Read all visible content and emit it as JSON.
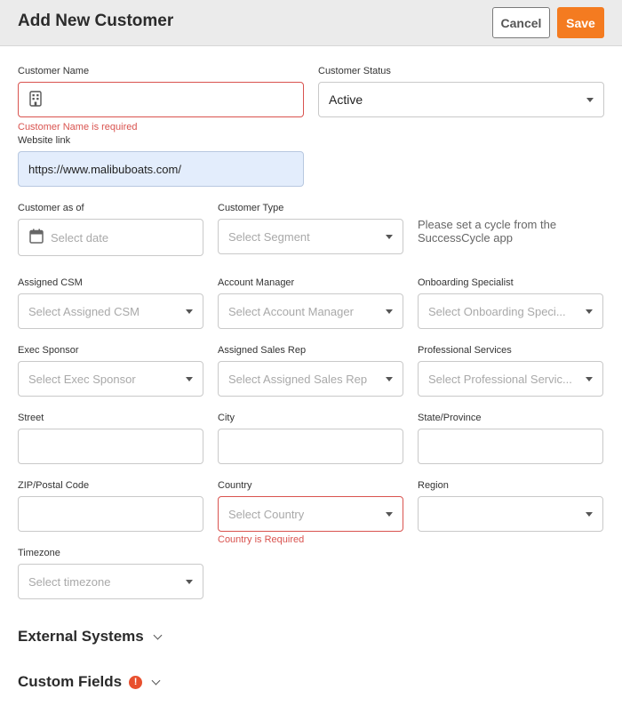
{
  "header": {
    "title": "Add New Customer",
    "cancel_label": "Cancel",
    "save_label": "Save"
  },
  "colors": {
    "accent": "#f47b20",
    "error": "#d9534f",
    "filled_field": "#e3edfc"
  },
  "form": {
    "customer_name": {
      "label": "Customer Name",
      "value": "",
      "icon": "building-icon",
      "error": "Customer Name is required"
    },
    "customer_status": {
      "label": "Customer Status",
      "value": "Active"
    },
    "website_link": {
      "label": "Website link",
      "value": "https://www.malibuboats.com/"
    },
    "customer_as_of": {
      "label": "Customer as of",
      "placeholder": "Select date",
      "icon": "calendar-icon"
    },
    "customer_type": {
      "label": "Customer Type",
      "placeholder": "Select Segment"
    },
    "cycle_note": "Please set a cycle from the SuccessCycle app",
    "assigned_csm": {
      "label": "Assigned CSM",
      "placeholder": "Select Assigned CSM"
    },
    "account_manager": {
      "label": "Account Manager",
      "placeholder": "Select Account Manager"
    },
    "onboarding_specialist": {
      "label": "Onboarding Specialist",
      "placeholder": "Select Onboarding Speci..."
    },
    "exec_sponsor": {
      "label": "Exec Sponsor",
      "placeholder": "Select Exec Sponsor"
    },
    "assigned_sales_rep": {
      "label": "Assigned Sales Rep",
      "placeholder": "Select Assigned Sales Rep"
    },
    "professional_services": {
      "label": "Professional Services",
      "placeholder": "Select Professional Servic..."
    },
    "street": {
      "label": "Street",
      "value": ""
    },
    "city": {
      "label": "City",
      "value": ""
    },
    "state": {
      "label": "State/Province",
      "value": ""
    },
    "zip": {
      "label": "ZIP/Postal Code",
      "value": ""
    },
    "country": {
      "label": "Country",
      "placeholder": "Select Country",
      "error": "Country is Required"
    },
    "region": {
      "label": "Region",
      "value": ""
    },
    "timezone": {
      "label": "Timezone",
      "placeholder": "Select timezone"
    }
  },
  "sections": {
    "external_systems": "External Systems",
    "custom_fields": "Custom Fields",
    "custom_fields_alert": "!"
  }
}
